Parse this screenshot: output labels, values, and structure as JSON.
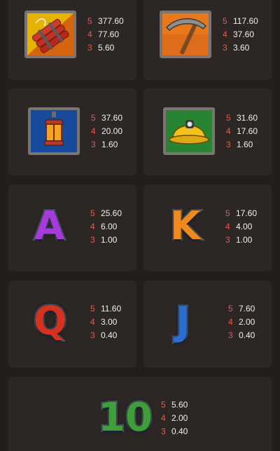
{
  "symbols": [
    {
      "name": "Dynamite",
      "icon": "dynamite-icon",
      "tile_color": "#e8b800",
      "pays": [
        {
          "count": "5",
          "value": "377.60"
        },
        {
          "count": "4",
          "value": "77.60"
        },
        {
          "count": "3",
          "value": "5.60"
        }
      ]
    },
    {
      "name": "Pickaxe",
      "icon": "pickaxe-icon",
      "tile_color": "#e4761b",
      "pays": [
        {
          "count": "5",
          "value": "117.60"
        },
        {
          "count": "4",
          "value": "37.60"
        },
        {
          "count": "3",
          "value": "3.60"
        }
      ]
    },
    {
      "name": "Lantern",
      "icon": "lantern-icon",
      "tile_color": "#1d58b4",
      "pays": [
        {
          "count": "5",
          "value": "37.60"
        },
        {
          "count": "4",
          "value": "20.00"
        },
        {
          "count": "3",
          "value": "1.60"
        }
      ]
    },
    {
      "name": "Miner Helmet",
      "icon": "helmet-icon",
      "tile_color": "#2f9a3a",
      "pays": [
        {
          "count": "5",
          "value": "31.60"
        },
        {
          "count": "4",
          "value": "17.60"
        },
        {
          "count": "3",
          "value": "1.60"
        }
      ]
    },
    {
      "name": "A",
      "icon": "letter-a-icon",
      "letter": "A",
      "letter_color": "#a63bdb",
      "pays": [
        {
          "count": "5",
          "value": "25.60"
        },
        {
          "count": "4",
          "value": "6.00"
        },
        {
          "count": "3",
          "value": "1.00"
        }
      ]
    },
    {
      "name": "K",
      "icon": "letter-k-icon",
      "letter": "K",
      "letter_color": "#f08a1c",
      "pays": [
        {
          "count": "5",
          "value": "17.60"
        },
        {
          "count": "4",
          "value": "4.00"
        },
        {
          "count": "3",
          "value": "1.00"
        }
      ]
    },
    {
      "name": "Q",
      "icon": "letter-q-icon",
      "letter": "Q",
      "letter_color": "#d7321f",
      "pays": [
        {
          "count": "5",
          "value": "11.60"
        },
        {
          "count": "4",
          "value": "3.00"
        },
        {
          "count": "3",
          "value": "0.40"
        }
      ]
    },
    {
      "name": "J",
      "icon": "letter-j-icon",
      "letter": "J",
      "letter_color": "#2a6fd0",
      "pays": [
        {
          "count": "5",
          "value": "7.60"
        },
        {
          "count": "4",
          "value": "2.00"
        },
        {
          "count": "3",
          "value": "0.40"
        }
      ]
    },
    {
      "name": "10",
      "icon": "ten-icon",
      "letter": "10",
      "letter_color": "#3f9d3a",
      "pays": [
        {
          "count": "5",
          "value": "5.60"
        },
        {
          "count": "4",
          "value": "2.00"
        },
        {
          "count": "3",
          "value": "0.40"
        }
      ]
    }
  ]
}
